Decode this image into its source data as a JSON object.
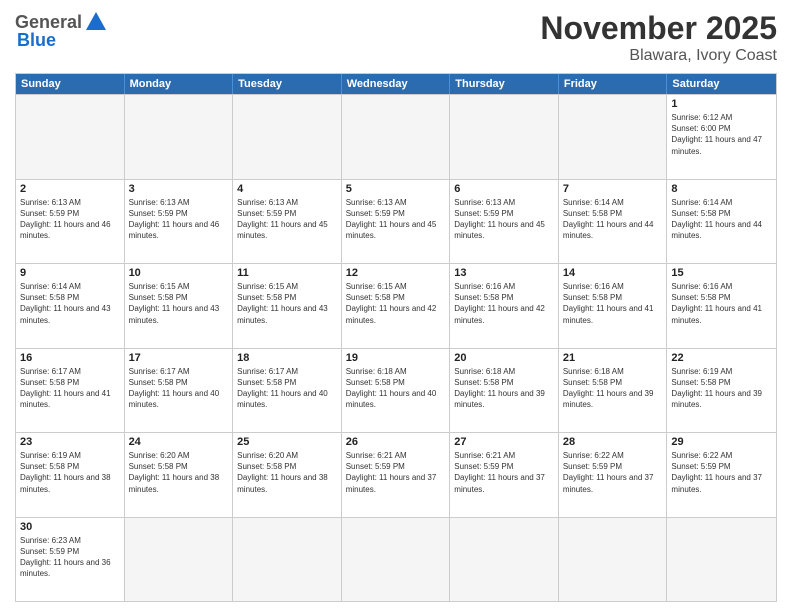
{
  "header": {
    "logo_general": "General",
    "logo_blue": "Blue",
    "title": "November 2025",
    "subtitle": "Blawara, Ivory Coast"
  },
  "calendar": {
    "days_of_week": [
      "Sunday",
      "Monday",
      "Tuesday",
      "Wednesday",
      "Thursday",
      "Friday",
      "Saturday"
    ],
    "weeks": [
      [
        {
          "day": "",
          "empty": true
        },
        {
          "day": "",
          "empty": true
        },
        {
          "day": "",
          "empty": true
        },
        {
          "day": "",
          "empty": true
        },
        {
          "day": "",
          "empty": true
        },
        {
          "day": "",
          "empty": true
        },
        {
          "day": "1",
          "sunrise": "6:12 AM",
          "sunset": "6:00 PM",
          "daylight": "11 hours and 47 minutes."
        }
      ],
      [
        {
          "day": "2",
          "sunrise": "6:13 AM",
          "sunset": "5:59 PM",
          "daylight": "11 hours and 46 minutes."
        },
        {
          "day": "3",
          "sunrise": "6:13 AM",
          "sunset": "5:59 PM",
          "daylight": "11 hours and 46 minutes."
        },
        {
          "day": "4",
          "sunrise": "6:13 AM",
          "sunset": "5:59 PM",
          "daylight": "11 hours and 45 minutes."
        },
        {
          "day": "5",
          "sunrise": "6:13 AM",
          "sunset": "5:59 PM",
          "daylight": "11 hours and 45 minutes."
        },
        {
          "day": "6",
          "sunrise": "6:13 AM",
          "sunset": "5:59 PM",
          "daylight": "11 hours and 45 minutes."
        },
        {
          "day": "7",
          "sunrise": "6:14 AM",
          "sunset": "5:58 PM",
          "daylight": "11 hours and 44 minutes."
        },
        {
          "day": "8",
          "sunrise": "6:14 AM",
          "sunset": "5:58 PM",
          "daylight": "11 hours and 44 minutes."
        }
      ],
      [
        {
          "day": "9",
          "sunrise": "6:14 AM",
          "sunset": "5:58 PM",
          "daylight": "11 hours and 43 minutes."
        },
        {
          "day": "10",
          "sunrise": "6:15 AM",
          "sunset": "5:58 PM",
          "daylight": "11 hours and 43 minutes."
        },
        {
          "day": "11",
          "sunrise": "6:15 AM",
          "sunset": "5:58 PM",
          "daylight": "11 hours and 43 minutes."
        },
        {
          "day": "12",
          "sunrise": "6:15 AM",
          "sunset": "5:58 PM",
          "daylight": "11 hours and 42 minutes."
        },
        {
          "day": "13",
          "sunrise": "6:16 AM",
          "sunset": "5:58 PM",
          "daylight": "11 hours and 42 minutes."
        },
        {
          "day": "14",
          "sunrise": "6:16 AM",
          "sunset": "5:58 PM",
          "daylight": "11 hours and 41 minutes."
        },
        {
          "day": "15",
          "sunrise": "6:16 AM",
          "sunset": "5:58 PM",
          "daylight": "11 hours and 41 minutes."
        }
      ],
      [
        {
          "day": "16",
          "sunrise": "6:17 AM",
          "sunset": "5:58 PM",
          "daylight": "11 hours and 41 minutes."
        },
        {
          "day": "17",
          "sunrise": "6:17 AM",
          "sunset": "5:58 PM",
          "daylight": "11 hours and 40 minutes."
        },
        {
          "day": "18",
          "sunrise": "6:17 AM",
          "sunset": "5:58 PM",
          "daylight": "11 hours and 40 minutes."
        },
        {
          "day": "19",
          "sunrise": "6:18 AM",
          "sunset": "5:58 PM",
          "daylight": "11 hours and 40 minutes."
        },
        {
          "day": "20",
          "sunrise": "6:18 AM",
          "sunset": "5:58 PM",
          "daylight": "11 hours and 39 minutes."
        },
        {
          "day": "21",
          "sunrise": "6:18 AM",
          "sunset": "5:58 PM",
          "daylight": "11 hours and 39 minutes."
        },
        {
          "day": "22",
          "sunrise": "6:19 AM",
          "sunset": "5:58 PM",
          "daylight": "11 hours and 39 minutes."
        }
      ],
      [
        {
          "day": "23",
          "sunrise": "6:19 AM",
          "sunset": "5:58 PM",
          "daylight": "11 hours and 38 minutes."
        },
        {
          "day": "24",
          "sunrise": "6:20 AM",
          "sunset": "5:58 PM",
          "daylight": "11 hours and 38 minutes."
        },
        {
          "day": "25",
          "sunrise": "6:20 AM",
          "sunset": "5:58 PM",
          "daylight": "11 hours and 38 minutes."
        },
        {
          "day": "26",
          "sunrise": "6:21 AM",
          "sunset": "5:59 PM",
          "daylight": "11 hours and 37 minutes."
        },
        {
          "day": "27",
          "sunrise": "6:21 AM",
          "sunset": "5:59 PM",
          "daylight": "11 hours and 37 minutes."
        },
        {
          "day": "28",
          "sunrise": "6:22 AM",
          "sunset": "5:59 PM",
          "daylight": "11 hours and 37 minutes."
        },
        {
          "day": "29",
          "sunrise": "6:22 AM",
          "sunset": "5:59 PM",
          "daylight": "11 hours and 37 minutes."
        }
      ],
      [
        {
          "day": "30",
          "sunrise": "6:23 AM",
          "sunset": "5:59 PM",
          "daylight": "11 hours and 36 minutes."
        },
        {
          "day": "",
          "empty": true
        },
        {
          "day": "",
          "empty": true
        },
        {
          "day": "",
          "empty": true
        },
        {
          "day": "",
          "empty": true
        },
        {
          "day": "",
          "empty": true
        },
        {
          "day": "",
          "empty": true
        }
      ]
    ]
  }
}
